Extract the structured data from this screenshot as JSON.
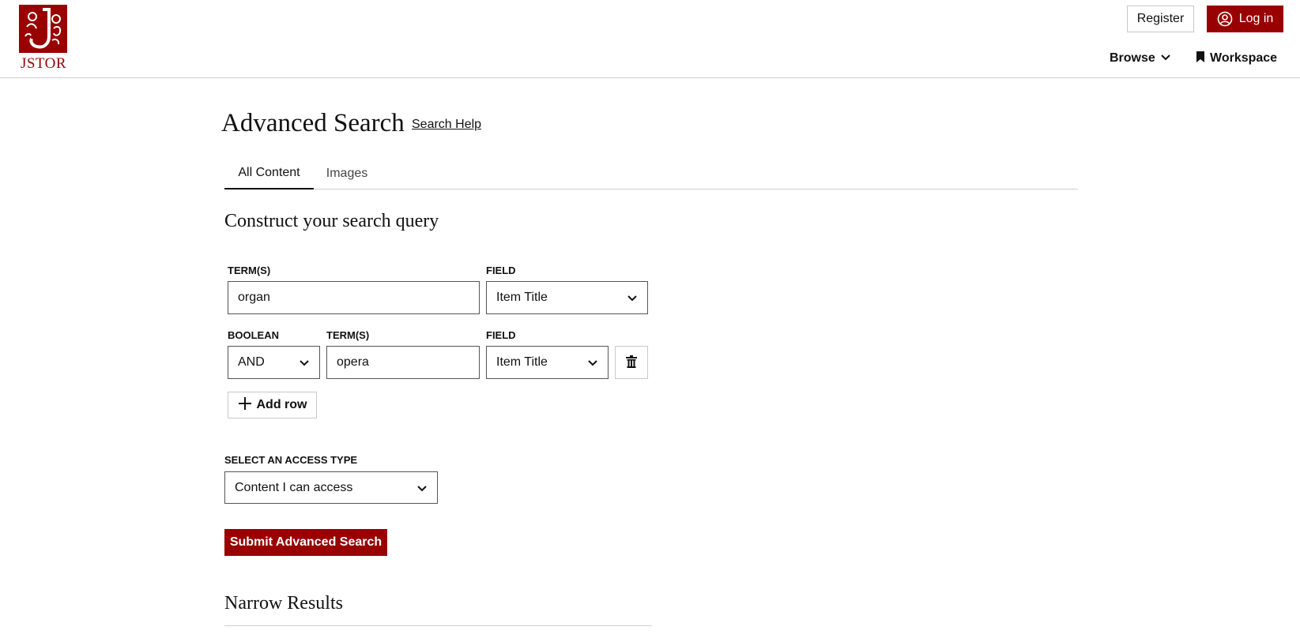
{
  "header": {
    "logo_text": "JSTOR",
    "register_label": "Register",
    "login_label": "Log in",
    "browse_label": "Browse",
    "workspace_label": "Workspace"
  },
  "main": {
    "title": "Advanced Search",
    "search_help_label": "Search Help",
    "tabs": [
      {
        "label": "All Content",
        "active": true
      },
      {
        "label": "Images",
        "active": false
      }
    ],
    "section_title": "Construct your search query",
    "row1": {
      "terms_label": "TERM(S)",
      "terms_value": "organ",
      "field_label": "FIELD",
      "field_value": "Item Title"
    },
    "row2": {
      "boolean_label": "BOOLEAN",
      "boolean_value": "AND",
      "terms_label": "TERM(S)",
      "terms_value": "opera",
      "field_label": "FIELD",
      "field_value": "Item Title"
    },
    "add_row_label": "Add row",
    "access_label": "SELECT AN ACCESS TYPE",
    "access_value": "Content I can access",
    "submit_label": "Submit Advanced Search",
    "narrow_title": "Narrow Results"
  },
  "colors": {
    "brand": "#990000",
    "border": "#555555",
    "divider": "#cfcfcf"
  },
  "icons": {
    "login": "user-circle-icon",
    "browse": "chevron-down-icon",
    "workspace": "bookmark-icon",
    "delete": "trash-icon",
    "add": "plus-icon",
    "select": "chevron-down-icon"
  }
}
